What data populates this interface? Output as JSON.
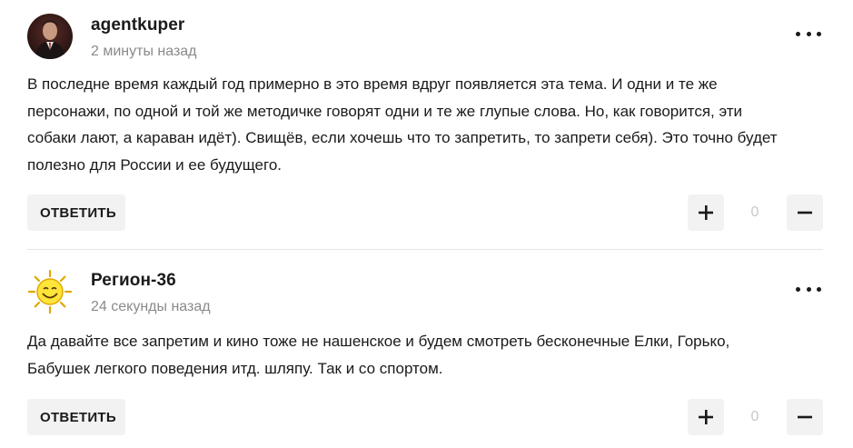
{
  "comments": [
    {
      "username": "agentkuper",
      "time": "2 минуты назад",
      "lines": [
        "В последне время каждый год примерно в это время вдруг появляется эта тема. И одни и те же",
        "персонажи, по одной и той же методичке говорят одни и те же глупые слова. Но, как говорится, эти",
        "собаки лают, а караван идёт). Свищёв, если хочешь что то запретить, то запрети себя). Это точно будет",
        "полезно для России и ее будущего."
      ],
      "reply_label": "ОТВЕТИТЬ",
      "score": "0",
      "avatar_icon": "user-photo-avatar"
    },
    {
      "username": "Регион-36",
      "time": "24 секунды назад",
      "lines": [
        "Да давайте все запретим и кино тоже не нашенское и будем смотреть бесконечные Елки, Горько,",
        "Бабушек легкого поведения итд. шляпу. Так и со спортом."
      ],
      "reply_label": "ОТВЕТИТЬ",
      "score": "0",
      "avatar_icon": "smiling-sun-avatar"
    }
  ],
  "icons": {
    "more": "more-dots-icon",
    "plus": "plus-icon",
    "minus": "minus-icon"
  },
  "colors": {
    "button_bg": "#f2f2f2",
    "muted_text": "#8a8a8a",
    "score_text": "#c8c8c8",
    "divider": "#e6e6e6"
  }
}
